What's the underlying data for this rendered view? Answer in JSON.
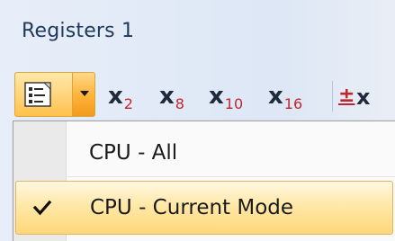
{
  "panel": {
    "title": "Registers 1"
  },
  "toolbar": {
    "view_button_icon": "register-list-icon",
    "base_buttons": [
      {
        "icon": "x",
        "sub": "2"
      },
      {
        "icon": "x",
        "sub": "8"
      },
      {
        "icon": "x",
        "sub": "10"
      },
      {
        "icon": "x",
        "sub": "16"
      }
    ],
    "sign_button": {
      "pm": "±",
      "x": "x"
    }
  },
  "menu": {
    "items": [
      {
        "label": "CPU - All",
        "checked": false
      },
      {
        "label": "CPU - Current Mode",
        "checked": true
      }
    ]
  },
  "colors": {
    "highlight": "#ffd77a",
    "accent_red": "#c0272d",
    "title_text": "#1e395b"
  }
}
